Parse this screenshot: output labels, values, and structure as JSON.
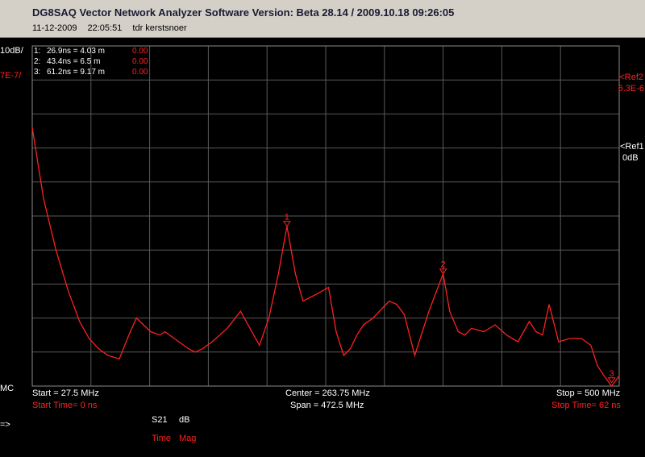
{
  "window": {
    "title": "DG8SAQ Vector Network Analyzer Software   Version:  Beta 28.14 / 2009.10.18 09:26:05",
    "date": "11-12-2009",
    "time": "22:05:51",
    "label": "tdr kerstsnoer"
  },
  "scale": {
    "db_per_div": "10dB/",
    "time_per_div": "7E-7/",
    "ref2_label": "<Ref2",
    "ref2_value": "6.3E-6",
    "ref1_label": "<Ref1",
    "ref1_value": "0dB",
    "mode": "MC",
    "arrow": "=>"
  },
  "markers": [
    {
      "id": "1:",
      "readout": "26.9ns = 4.03 m",
      "value": "0.00"
    },
    {
      "id": "2:",
      "readout": "43.4ns = 6.5 m",
      "value": "0.00"
    },
    {
      "id": "3:",
      "readout": "61.2ns = 9.17 m",
      "value": "0.00"
    }
  ],
  "footer": {
    "start": "Start = 27.5 MHz",
    "start_time": "Start Time= 0 ns",
    "center": "Center = 263.75 MHz",
    "span": "Span = 472.5 MHz",
    "stop": "Stop = 500 MHz",
    "stop_time": "Stop Time= 62 ns",
    "trace_param": "S21",
    "trace_unit": "dB",
    "trace_domain": "Time",
    "trace_format": "Mag"
  },
  "chart_data": {
    "type": "line",
    "xlim": [
      0,
      62
    ],
    "ylim": [
      -100,
      0
    ],
    "grid": true,
    "trace_color": "#ff2020",
    "series": [
      {
        "x": [
          0,
          1.2,
          2.5,
          3.8,
          5.0,
          6.0,
          7.0,
          8.0,
          9.2,
          10.2,
          11.0,
          12.5,
          13.5,
          14.0,
          15.5,
          16.5,
          17.2,
          18.0,
          19.0,
          20.6,
          22.0,
          24.0,
          25.0,
          26.0,
          26.9,
          27.8,
          28.6,
          30.0,
          31.3,
          32.1,
          32.9,
          33.6,
          34.3,
          35.0,
          36.0,
          37.7,
          38.5,
          39.3,
          40.4,
          41.9,
          43.4,
          44.1,
          45.0,
          45.7,
          46.4,
          47.7,
          48.9,
          50.1,
          51.3,
          52.5,
          53.2,
          53.9,
          54.6,
          55.6,
          56.8,
          58.0,
          59.0,
          59.7,
          60.4,
          61.2,
          62.0
        ],
        "y": [
          -24,
          -45,
          -60,
          -72,
          -81,
          -86,
          -89,
          -91,
          -92,
          -85,
          -80,
          -84,
          -85,
          -84,
          -87,
          -89,
          -90,
          -89,
          -87,
          -83,
          -78,
          -88,
          -80,
          -67,
          -53,
          -67,
          -75,
          -73,
          -71,
          -84,
          -91,
          -89,
          -85,
          -82,
          -80,
          -75,
          -76,
          -79,
          -91,
          -78,
          -67,
          -78,
          -84,
          -85,
          -83,
          -84,
          -82,
          -85,
          -87,
          -81,
          -84,
          -85,
          -76,
          -87,
          -86,
          -86,
          -88,
          -94,
          -97,
          -100,
          -97
        ]
      }
    ],
    "markers": [
      {
        "label": "1",
        "x": 26.9,
        "y": -53
      },
      {
        "label": "2",
        "x": 43.4,
        "y": -67
      },
      {
        "label": "3",
        "x": 61.2,
        "y": -99
      }
    ]
  }
}
